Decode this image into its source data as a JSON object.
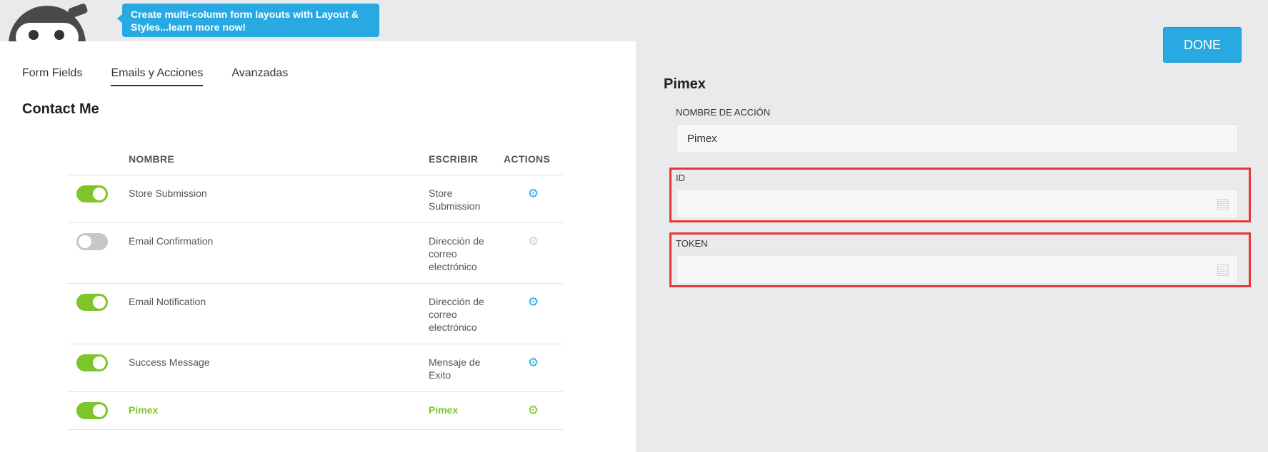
{
  "banner": {
    "text": "Create multi-column form layouts with Layout & Styles...learn more now!"
  },
  "tabs": [
    {
      "label": "Form Fields"
    },
    {
      "label": "Emails y Acciones"
    },
    {
      "label": "Avanzadas"
    }
  ],
  "form": {
    "title": "Contact Me"
  },
  "table": {
    "headers": {
      "name": "NOMBRE",
      "write": "ESCRIBIR",
      "actions": "ACTIONS"
    },
    "rows": [
      {
        "name": "Store Submission",
        "write": "Store Submission",
        "enabled": true
      },
      {
        "name": "Email Confirmation",
        "write": "Dirección de correo electrónico",
        "enabled": false
      },
      {
        "name": "Email Notification",
        "write": "Dirección de correo electrónico",
        "enabled": true
      },
      {
        "name": "Success Message",
        "write": "Mensaje de Exito",
        "enabled": true
      },
      {
        "name": "Pimex",
        "write": "Pimex",
        "enabled": true,
        "active": true
      }
    ]
  },
  "done_button": {
    "label": "DONE"
  },
  "detail": {
    "title": "Pimex",
    "action_name_label": "NOMBRE DE ACCIÓN",
    "action_name_value": "Pimex",
    "id_label": "ID",
    "id_value": "",
    "token_label": "TOKEN",
    "token_value": ""
  },
  "colors": {
    "accent": "#29a9e1",
    "toggle_on": "#7dc52b",
    "highlight": "#e53935"
  }
}
